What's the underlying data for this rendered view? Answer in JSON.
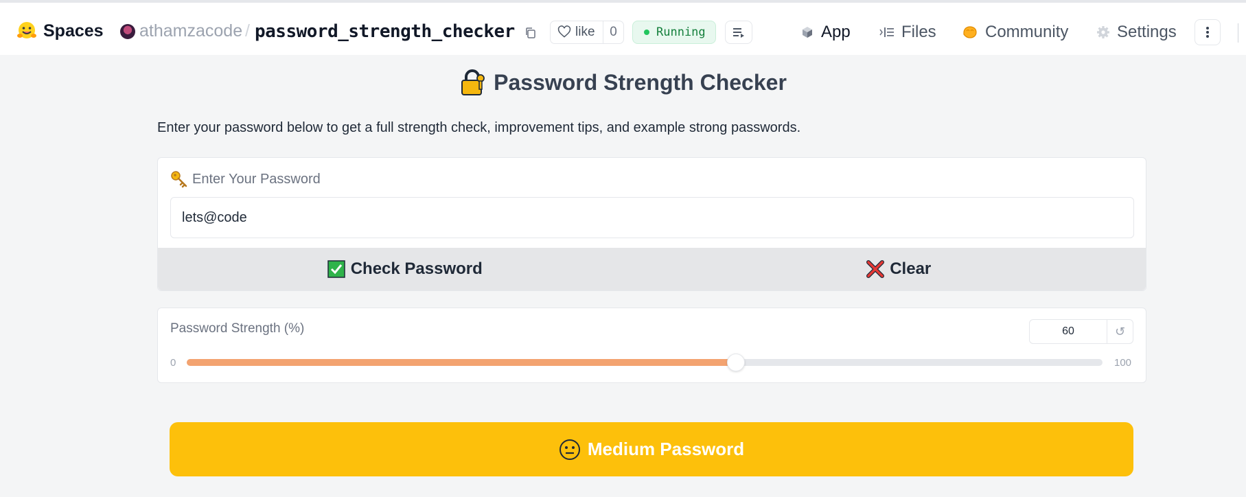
{
  "header": {
    "spaces_label": "Spaces",
    "owner": "athamzacode",
    "separator": "/",
    "repo": "password_strength_checker",
    "like_label": "like",
    "like_count": "0",
    "status": "Running",
    "tabs": [
      {
        "label": "App",
        "icon": "cube-icon"
      },
      {
        "label": "Files",
        "icon": "files-icon"
      },
      {
        "label": "Community",
        "icon": "community-icon"
      },
      {
        "label": "Settings",
        "icon": "gear-icon"
      }
    ],
    "active_tab": "App"
  },
  "app": {
    "title": "Password Strength Checker",
    "description": "Enter your password below to get a full strength check, improvement tips, and example strong passwords.",
    "password_label": "Enter Your Password",
    "password_value": "lets@code",
    "check_button": "Check Password",
    "clear_button": "Clear",
    "strength_label": "Password Strength (%)",
    "strength_value": "60",
    "strength_min": "0",
    "strength_max": "100",
    "strength_fraction": 0.6,
    "result_text": "Medium Password"
  },
  "colors": {
    "accent_fill": "#f3a370",
    "result_bg": "#fdc00b",
    "status_green": "#22c55e"
  }
}
